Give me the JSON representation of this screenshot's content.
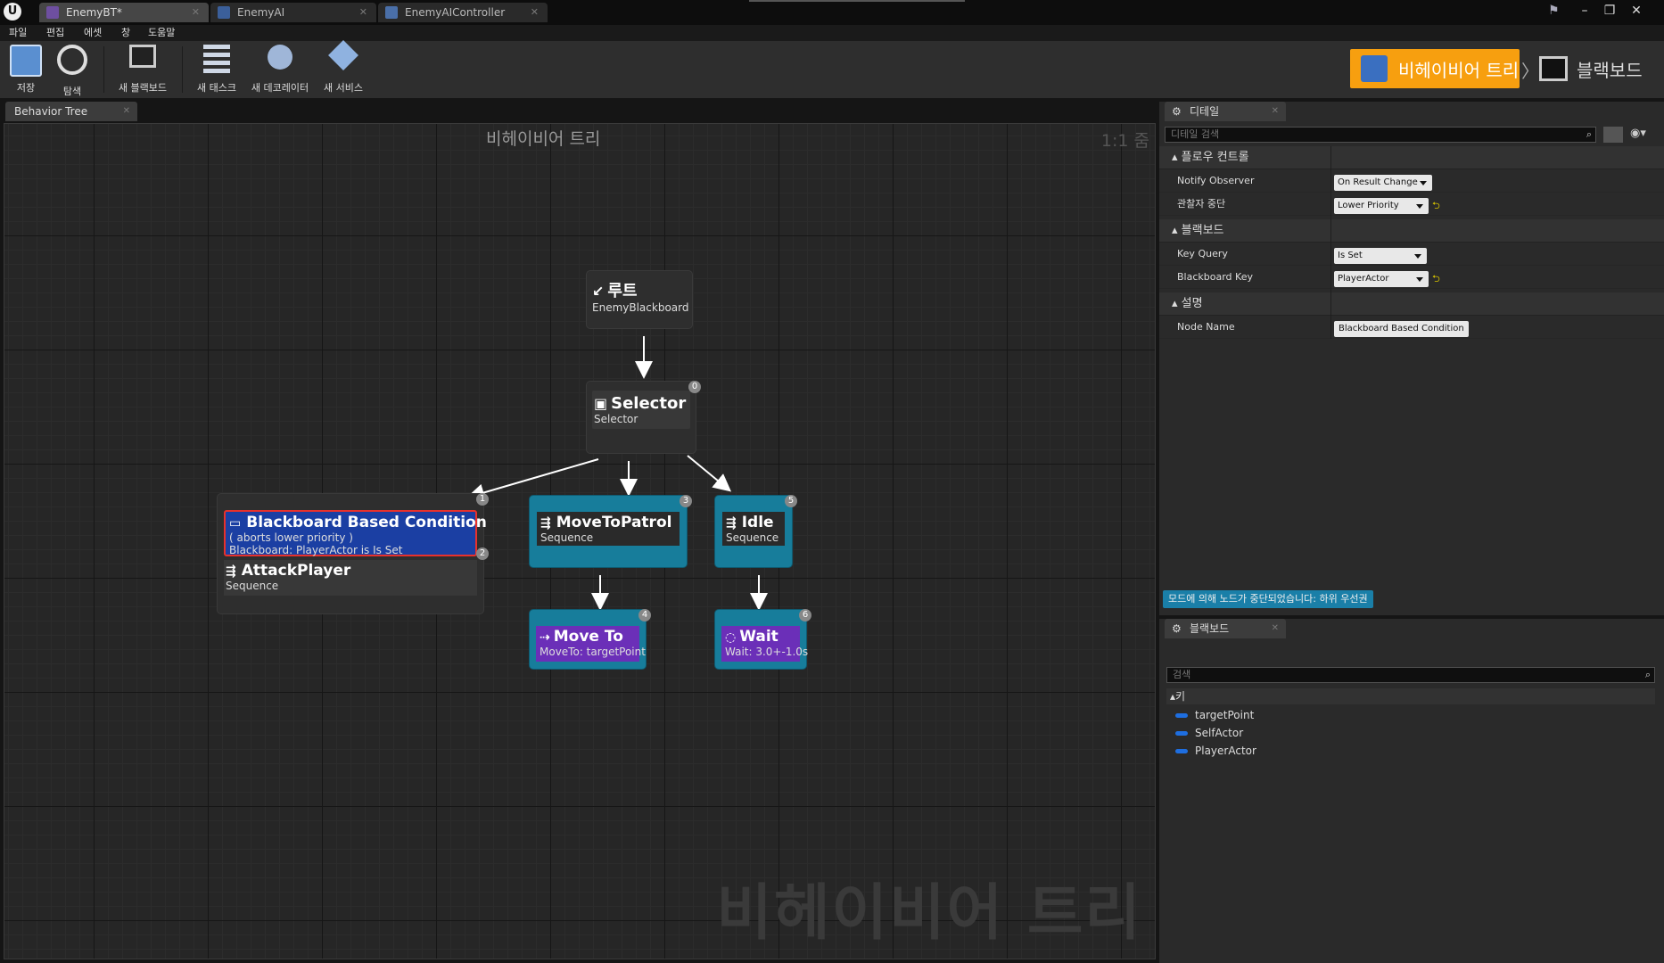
{
  "window": {
    "tabs": [
      {
        "label": "EnemyBT*",
        "active": true
      },
      {
        "label": "EnemyAI",
        "active": false
      },
      {
        "label": "EnemyAIController",
        "active": false
      }
    ]
  },
  "menu": [
    "파일",
    "편집",
    "에셋",
    "창",
    "도움말"
  ],
  "toolbar": {
    "save": "저장",
    "browse": "탐색",
    "new_blackboard": "새 블랙보드",
    "new_task": "새 태스크",
    "new_decorator": "새 데코레이터",
    "new_service": "새 서비스",
    "mode_behavior_tree": "비헤이비어 트리",
    "mode_blackboard": "블랙보드"
  },
  "graph": {
    "tab_label": "Behavior Tree",
    "title": "비헤이비어 트리",
    "zoom": "1:1 줌",
    "watermark": "비헤이비어 트리",
    "nodes": {
      "root": {
        "title": "루트",
        "sub": "EnemyBlackboard"
      },
      "selector": {
        "title": "Selector",
        "sub": "Selector",
        "index": "0"
      },
      "attack": {
        "decorator_title": "Blackboard Based Condition",
        "decorator_line1": "( aborts lower priority )",
        "decorator_line2": "Blackboard: PlayerActor is Is Set",
        "decorator_index": "1",
        "title": "AttackPlayer",
        "sub": "Sequence",
        "index": "2"
      },
      "patrol": {
        "title": "MoveToPatrol",
        "sub": "Sequence",
        "index": "3"
      },
      "idle": {
        "title": "Idle",
        "sub": "Sequence",
        "index": "5"
      },
      "moveto": {
        "title": "Move To",
        "sub": "MoveTo: targetPoint",
        "index": "4"
      },
      "wait": {
        "title": "Wait",
        "sub": "Wait: 3.0+-1.0s",
        "index": "6"
      }
    }
  },
  "details": {
    "tab_label": "디테일",
    "search_placeholder": "디테일 검색",
    "sections": {
      "flow": "플로우 컨트롤",
      "blackboard": "블랙보드",
      "description": "설명"
    },
    "rows": {
      "notify_observer": {
        "label": "Notify Observer",
        "value": "On Result Change"
      },
      "observer_aborts": {
        "label": "관찰자 중단",
        "value": "Lower Priority"
      },
      "key_query": {
        "label": "Key Query",
        "value": "Is Set"
      },
      "blackboard_key": {
        "label": "Blackboard Key",
        "value": "PlayerActor"
      },
      "node_name": {
        "label": "Node Name",
        "value": "Blackboard Based Condition"
      }
    },
    "info": "모드에 의해 노드가 중단되었습니다: 하위 우선권"
  },
  "blackboard_panel": {
    "tab_label": "블랙보드",
    "search_placeholder": "검색",
    "keys_header": "키",
    "keys": [
      "targetPoint",
      "SelfActor",
      "PlayerActor"
    ]
  },
  "colors": {
    "mode_active": "#f79f0f",
    "composite": "#3a3a3a",
    "sequence_border": "#177d9b",
    "task": "#6b2fb8",
    "decorator": "#1b3fa3",
    "selection": "#e8312c"
  }
}
